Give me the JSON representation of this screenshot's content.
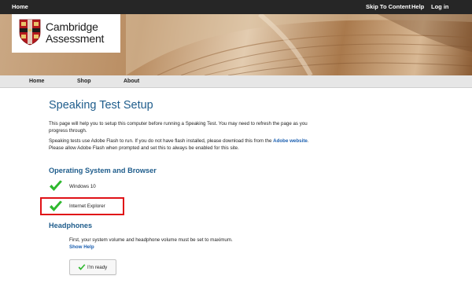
{
  "topbar": {
    "home": "Home",
    "skip": "Skip To Content",
    "help": "Help",
    "login": "Log in"
  },
  "logo": {
    "line1": "Cambridge",
    "line2": "Assessment"
  },
  "nav": {
    "home": "Home",
    "shop": "Shop",
    "about": "About"
  },
  "page": {
    "title": "Speaking Test Setup",
    "intro": "This page will help you to setup this computer before running a Speaking Test. You may need to refresh the page as you progress through.",
    "flash_before": "Speaking tests use Adobe Flash to run. If you do not have flash installed, please download this from the ",
    "flash_link": "Adobe website",
    "flash_after": ". Please allow Adobe Flash when prompted and set this to always be enabled for this site."
  },
  "os_section": {
    "title": "Operating System and Browser",
    "os": "Windows 10",
    "browser": "Internet Explorer"
  },
  "headphones": {
    "title": "Headphones",
    "text": "First, your system volume and headphone volume must be set to maximum. ",
    "show_help": "Show Help",
    "ready_label": "I'm ready"
  },
  "colors": {
    "heading_blue": "#1f5d8c",
    "link_blue": "#1b5fb0",
    "check_green": "#2eb82e",
    "highlight_red": "#e01217",
    "topbar": "#262626"
  },
  "icons": {
    "check": "check-icon",
    "shield": "cambridge-shield-icon"
  }
}
